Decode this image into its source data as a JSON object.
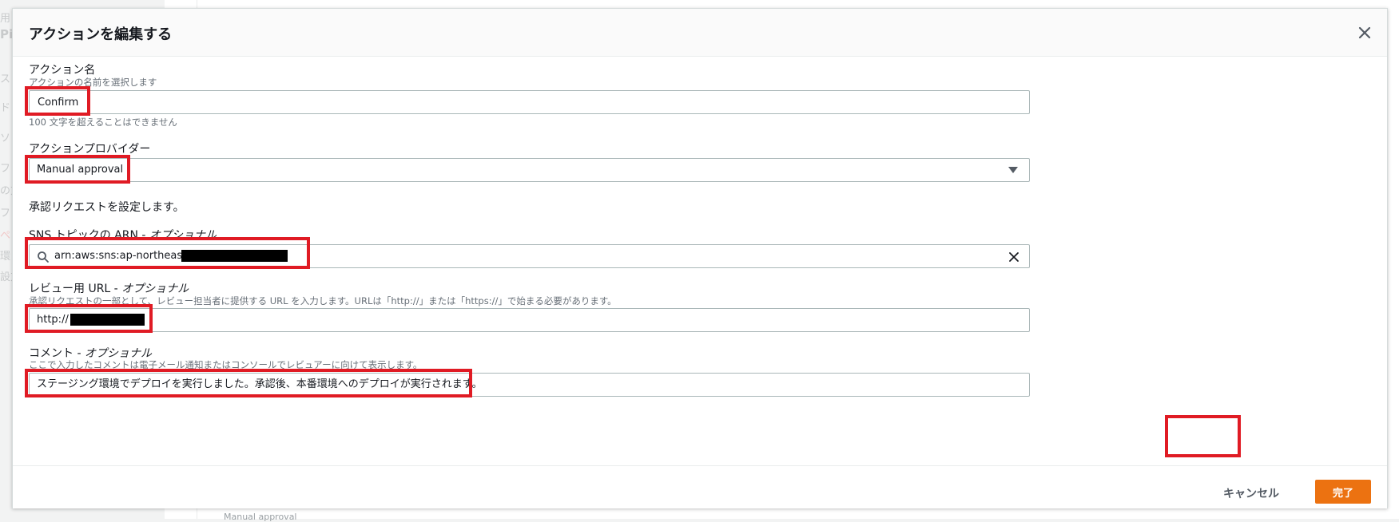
{
  "background": {
    "labels": [
      "用",
      "Pi",
      "ス",
      "ド",
      "ソ",
      "フ",
      "の方",
      "フ",
      "ペ",
      "環",
      "設方"
    ],
    "footer_left": "Manual approval"
  },
  "modal": {
    "title": "アクションを編集する",
    "action_name": {
      "label": "アクション名",
      "description": "アクションの名前を選択します",
      "value": "Confirm",
      "constraint": "100 文字を超えることはできません"
    },
    "action_provider": {
      "label": "アクションプロバイダー",
      "value": "Manual approval"
    },
    "approval_section": "承認リクエストを設定します。",
    "sns_topic": {
      "label": "SNS トピックの ARN",
      "optional": "オプショナル",
      "value": "arn:aws:sns:ap-northeast-1:"
    },
    "review_url": {
      "label": "レビュー用 URL",
      "optional": "オプショナル",
      "description": "承認リクエストの一部として、レビュー担当者に提供する URL を入力します。URLは「http://」または「https://」で始まる必要があります。",
      "value": "http://"
    },
    "comment": {
      "label": "コメント",
      "optional": "オプショナル",
      "description": "ここで入力したコメントは電子メール通知またはコンソールでレビュアーに向けて表示します。",
      "value": "ステージング環境でデプロイを実行しました。承認後、本番環境へのデプロイが実行されます。"
    },
    "footer": {
      "cancel_label": "キャンセル",
      "done_label": "完了"
    }
  },
  "colors": {
    "primary_button": "#ec7211",
    "highlight": "#e01b24",
    "redaction": "#000000"
  }
}
